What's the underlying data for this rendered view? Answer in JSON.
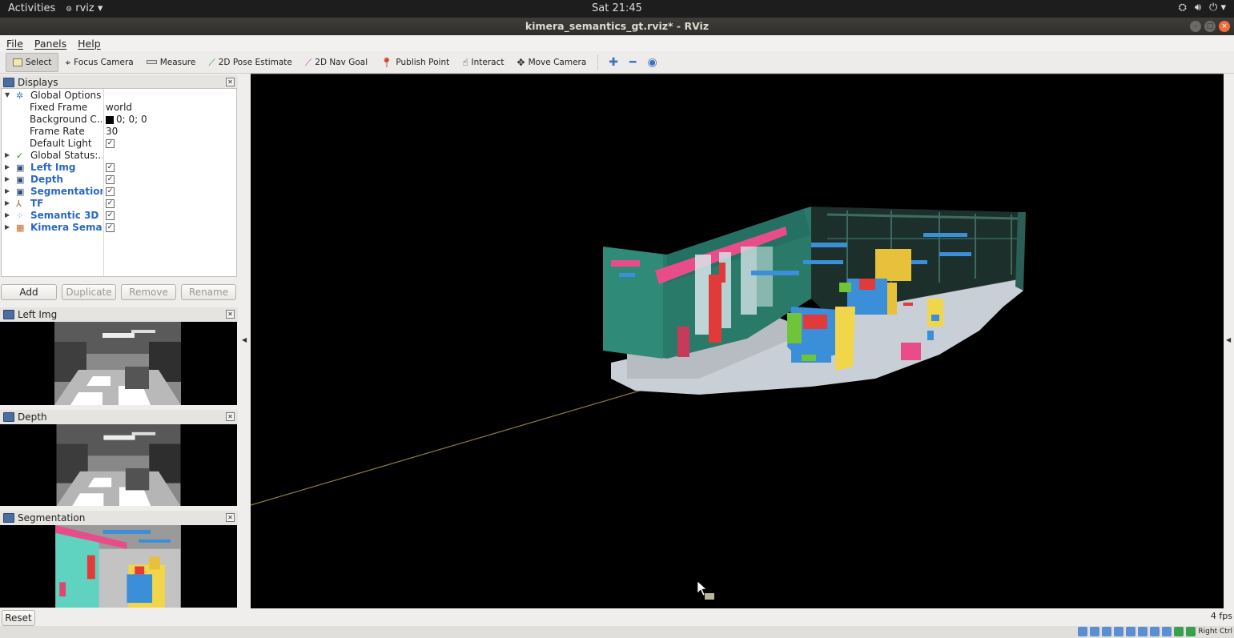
{
  "topbar": {
    "activities": "Activities",
    "app_menu": "rviz",
    "clock": "Sat 21:45"
  },
  "window": {
    "title": "kimera_semantics_gt.rviz* - RViz"
  },
  "menu": {
    "file": "File",
    "panels": "Panels",
    "help": "Help"
  },
  "toolbar": {
    "select": "Select",
    "focus_camera": "Focus Camera",
    "measure": "Measure",
    "pose_estimate": "2D Pose Estimate",
    "nav_goal": "2D Nav Goal",
    "publish_point": "Publish Point",
    "interact": "Interact",
    "move_camera": "Move Camera"
  },
  "displays_panel": {
    "title": "Displays",
    "global_options": "Global Options",
    "fixed_frame_label": "Fixed Frame",
    "fixed_frame_value": "world",
    "background_label": "Background C...",
    "background_value": "0; 0; 0",
    "frame_rate_label": "Frame Rate",
    "frame_rate_value": "30",
    "default_light_label": "Default Light",
    "global_status": "Global Status:...",
    "items": [
      {
        "label": "Left Img",
        "checked": true
      },
      {
        "label": "Depth",
        "checked": true
      },
      {
        "label": "Segmentation",
        "checked": true
      },
      {
        "label": "TF",
        "checked": true
      },
      {
        "label": "Semantic 3D ...",
        "checked": true
      },
      {
        "label": "Kimera Sema...",
        "checked": true
      }
    ],
    "buttons": {
      "add": "Add",
      "duplicate": "Duplicate",
      "remove": "Remove",
      "rename": "Rename"
    }
  },
  "image_panels": {
    "left_img": "Left Img",
    "depth": "Depth",
    "segmentation": "Segmentation"
  },
  "statusbar": {
    "reset": "Reset",
    "fps": "4 fps"
  },
  "vmbar": {
    "host_key": "Right Ctrl"
  }
}
